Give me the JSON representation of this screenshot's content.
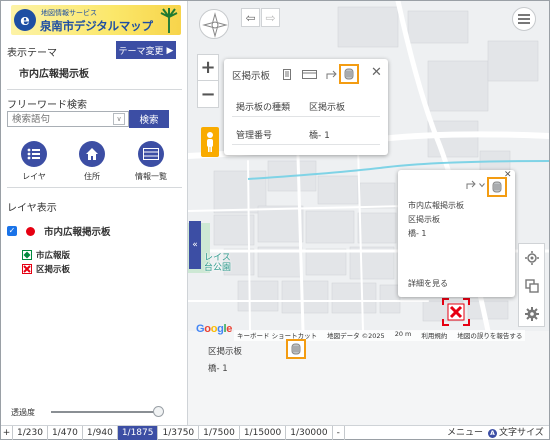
{
  "header": {
    "logo_subtitle": "地図情報サービス",
    "logo_title": "泉南市デジタルマップ"
  },
  "sidebar": {
    "theme_label": "表示テーマ",
    "theme_button": "テーマ変更",
    "theme_name": "市内広報掲示板",
    "keyword_label": "フリーワード検索",
    "keyword_placeholder": "検索語句",
    "search_button": "検索",
    "tools": [
      {
        "label": "レイヤ",
        "icon": "list-icon"
      },
      {
        "label": "住所",
        "icon": "house-icon"
      },
      {
        "label": "情報一覧",
        "icon": "table-icon"
      }
    ],
    "layer_label": "レイヤ表示",
    "layer_name": "市内広報掲示板",
    "layer_checked": true,
    "legend": [
      {
        "label": "市広報版",
        "color": "#008a3d"
      },
      {
        "label": "区掲示板",
        "color": "#e60012"
      }
    ],
    "opacity_label": "透過度",
    "opacity_value": 1.0
  },
  "map": {
    "park_label_1": "レイス",
    "park_label_2": "台公園",
    "popup1": {
      "title": "区掲示板",
      "rows": [
        {
          "key": "掲示板の種類",
          "value": "区掲示板"
        },
        {
          "key": "管理番号",
          "value": "橋- 1"
        }
      ]
    },
    "popup2": {
      "line1": "市内広報掲示板",
      "line2": "区掲示板",
      "line3": "橋- 1",
      "more": "詳細を見る"
    },
    "google": "Google",
    "attribution": [
      "キーボード ショートカット",
      "地図データ ©2025",
      "20 m",
      "利用規約",
      "地図の誤りを報告する"
    ],
    "hover": {
      "line1": "区掲示板",
      "line2": "橋- 1"
    },
    "collapse_arrow": "«",
    "colors": {
      "accent": "#3c4ea4",
      "highlight": "#f39c12",
      "river": "#7fd3e6"
    }
  },
  "bottombar": {
    "plus": "+",
    "scales": [
      "1/230",
      "1/470",
      "1/940",
      "1/1875",
      "1/3750",
      "1/7500",
      "1/15000",
      "1/30000"
    ],
    "active_scale": "1/1875",
    "minus": "-",
    "menu": "メニュー",
    "font_icon": "A",
    "font_label": "文字サイズ"
  }
}
